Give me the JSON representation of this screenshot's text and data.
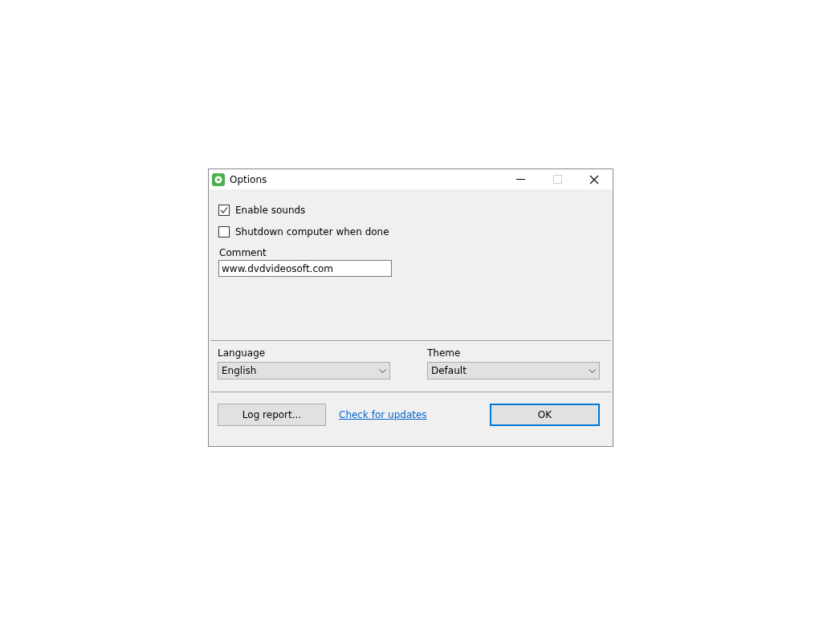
{
  "window": {
    "title": "Options"
  },
  "checkboxes": [
    {
      "label": "Enable sounds",
      "checked": true
    },
    {
      "label": "Shutdown computer when done",
      "checked": false
    }
  ],
  "comment": {
    "label": "Comment",
    "value": "www.dvdvideosoft.com"
  },
  "selects": [
    {
      "label": "Language",
      "value": "English"
    },
    {
      "label": "Theme",
      "value": "Default"
    }
  ],
  "log_button": {
    "label": "Log report...",
    "focused": false
  },
  "update_link": "Check for updates",
  "ok_button": {
    "label": "OK",
    "focused": true
  }
}
